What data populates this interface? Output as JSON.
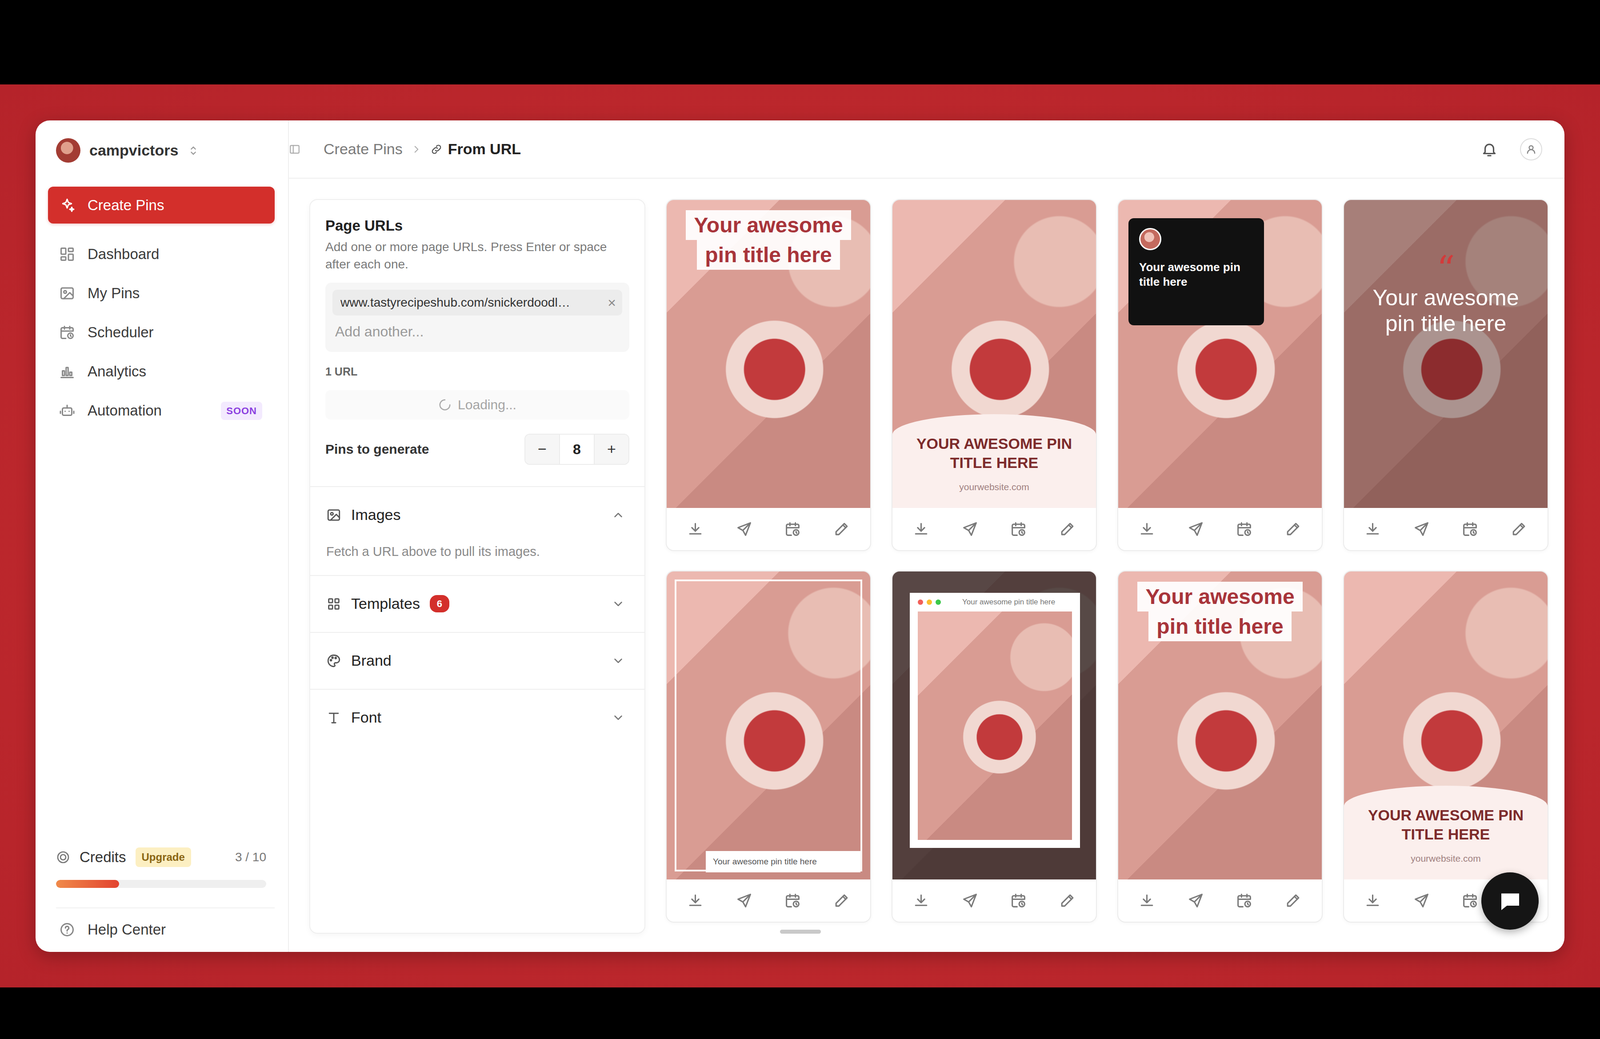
{
  "workspace": {
    "name": "campvictors"
  },
  "sidebar": {
    "items": [
      {
        "label": "Create Pins",
        "selected": true
      },
      {
        "label": "Dashboard",
        "selected": false
      },
      {
        "label": "My Pins",
        "selected": false
      },
      {
        "label": "Scheduler",
        "selected": false
      },
      {
        "label": "Analytics",
        "selected": false
      },
      {
        "label": "Automation",
        "selected": false,
        "badge": "SOON"
      }
    ]
  },
  "credits": {
    "label": "Credits",
    "upgrade": "Upgrade",
    "count": "3 / 10",
    "level": 0.3
  },
  "help": {
    "label": "Help Center"
  },
  "breadcrumb": [
    {
      "label": "Create Pins",
      "current": false
    },
    {
      "label": "From URL",
      "current": true
    }
  ],
  "page_urls": {
    "title": "Page URLs",
    "hint": "Add one or more page URLs. Press Enter or space after each one.",
    "urls": [
      {
        "text": "www.tastyrecipeshub.com/snickerdoodl…",
        "remove": "×"
      }
    ],
    "placeholder": "Add another...",
    "count": "1 URL",
    "status": "Loading..."
  },
  "pins_to_generate": {
    "label": "Pins to generate",
    "value": "8",
    "minus": "−",
    "plus": "+"
  },
  "sections": [
    {
      "label": "Images",
      "expanded": true,
      "body": "Fetch a URL above to pull its images."
    },
    {
      "label": "Templates",
      "expanded": false,
      "count": "6"
    },
    {
      "label": "Brand",
      "expanded": false
    },
    {
      "label": "Font",
      "expanded": false
    }
  ],
  "pins": [
    {
      "kind": "top-banner",
      "lines": [
        "Your awesome",
        "pin title here"
      ]
    },
    {
      "kind": "bottom-arc",
      "lines": [
        "YOUR AWESOME PIN",
        "TITLE HERE"
      ],
      "site": "yourwebsite.com"
    },
    {
      "kind": "dark-card",
      "lines": [
        "Your awesome pin",
        "title here"
      ]
    },
    {
      "kind": "quote",
      "mark": "“",
      "lines": [
        "Your awesome",
        "pin title here"
      ]
    },
    {
      "kind": "frame",
      "lines": [
        "Your awesome pin title here"
      ]
    },
    {
      "kind": "browser",
      "lines": [
        "Your awesome pin title here"
      ]
    },
    {
      "kind": "top-banner",
      "lines": [
        "Your awesome",
        "pin title here"
      ]
    },
    {
      "kind": "bottom-arc",
      "lines": [
        "YOUR AWESOME PIN",
        "TITLE HERE"
      ],
      "site": "yourwebsite.com"
    }
  ]
}
